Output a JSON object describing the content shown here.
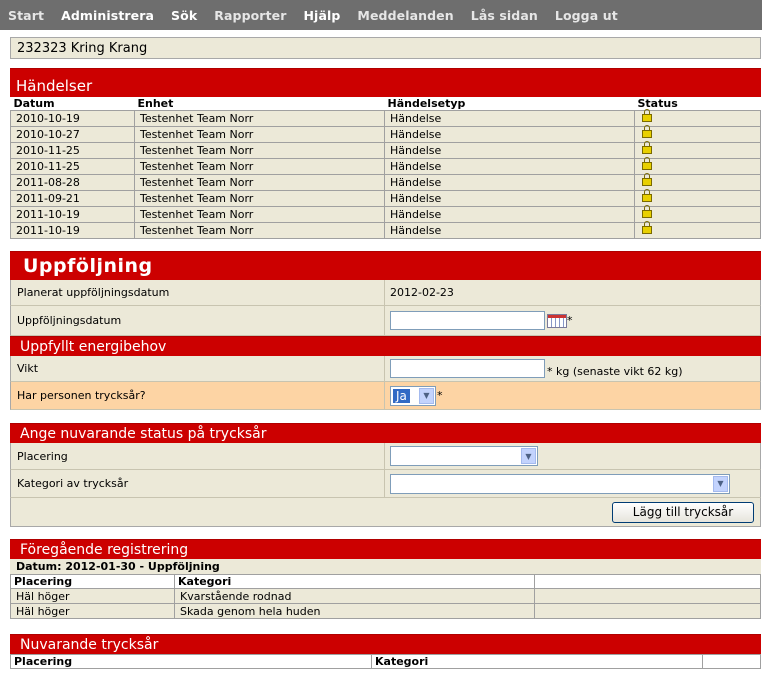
{
  "nav": [
    "Start",
    "Administrera",
    "Sök",
    "Rapporter",
    "Hjälp",
    "Meddelanden",
    "Lås sidan",
    "Logga ut"
  ],
  "patient": "232323 Kring Krang",
  "handelser": {
    "title": "Händelser",
    "columns": [
      "Datum",
      "Enhet",
      "Händelsetyp",
      "Status"
    ],
    "rows": [
      {
        "datum": "2010-10-19",
        "enhet": "Testenhet Team Norr",
        "typ": "Händelse",
        "status": "lock-icon"
      },
      {
        "datum": "2010-10-27",
        "enhet": "Testenhet Team Norr",
        "typ": "Händelse",
        "status": "lock-icon"
      },
      {
        "datum": "2010-11-25",
        "enhet": "Testenhet Team Norr",
        "typ": "Händelse",
        "status": "lock-icon"
      },
      {
        "datum": "2010-11-25",
        "enhet": "Testenhet Team Norr",
        "typ": "Händelse",
        "status": "lock-icon"
      },
      {
        "datum": "2011-08-28",
        "enhet": "Testenhet Team Norr",
        "typ": "Händelse",
        "status": "lock-icon"
      },
      {
        "datum": "2011-09-21",
        "enhet": "Testenhet Team Norr",
        "typ": "Händelse",
        "status": "lock-icon"
      },
      {
        "datum": "2011-10-19",
        "enhet": "Testenhet Team Norr",
        "typ": "Händelse",
        "status": "lock-icon"
      },
      {
        "datum": "2011-10-19",
        "enhet": "Testenhet Team Norr",
        "typ": "Händelse",
        "status": "lock-icon"
      }
    ]
  },
  "uppfoljning": {
    "title": "Uppföljning",
    "planerat_label": "Planerat uppföljningsdatum",
    "planerat_value": "2012-02-23",
    "datum_label": "Uppföljningsdatum",
    "datum_value": "",
    "required": "*",
    "energi_title": "Uppfyllt energibehov",
    "vikt_label": "Vikt",
    "vikt_value": "",
    "vikt_note": "* kg (senaste vikt 62 kg)",
    "tryck_label": "Har personen trycksår?",
    "tryck_value": "Ja"
  },
  "status": {
    "title": "Ange nuvarande status på trycksår",
    "placering_label": "Placering",
    "placering_value": "",
    "kategori_label": "Kategori av trycksår",
    "kategori_value": "",
    "add_button": "Lägg till trycksår"
  },
  "foregaende": {
    "title": "Föregående registrering",
    "datum": "Datum: 2012-01-30 - Uppföljning",
    "columns": [
      "Placering",
      "Kategori"
    ],
    "rows": [
      {
        "placering": "Häl höger",
        "kategori": "Kvarstående rodnad"
      },
      {
        "placering": "Häl höger",
        "kategori": "Skada genom hela huden"
      }
    ]
  },
  "nuvarande": {
    "title": "Nuvarande trycksår",
    "columns": [
      "Placering",
      "Kategori"
    ]
  },
  "colors": {
    "header_red": "#cc0000",
    "panel_bg": "#ece9d8",
    "highlight": "#fdd4a4",
    "nav_bg": "#6e6e6e"
  }
}
